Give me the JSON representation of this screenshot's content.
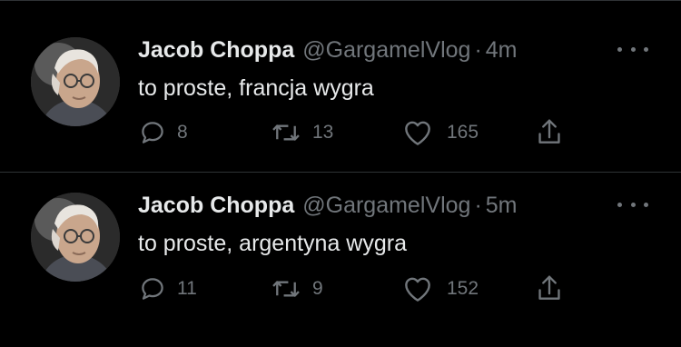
{
  "tweets": [
    {
      "author_name": "Jacob Choppa",
      "handle": "@GargamelVlog",
      "separator": "·",
      "time": "4m",
      "text": "to proste, francja wygra",
      "replies": "8",
      "retweets": "13",
      "likes": "165"
    },
    {
      "author_name": "Jacob Choppa",
      "handle": "@GargamelVlog",
      "separator": "·",
      "time": "5m",
      "text": "to proste, argentyna wygra",
      "replies": "11",
      "retweets": "9",
      "likes": "152"
    }
  ],
  "icons": {
    "reply": "reply-icon",
    "retweet": "retweet-icon",
    "like": "heart-icon",
    "share": "share-icon",
    "more": "more-options-icon"
  },
  "colors": {
    "background": "#000000",
    "primary_text": "#e7e9ea",
    "secondary_text": "#71767b",
    "divider": "#2f3336"
  }
}
